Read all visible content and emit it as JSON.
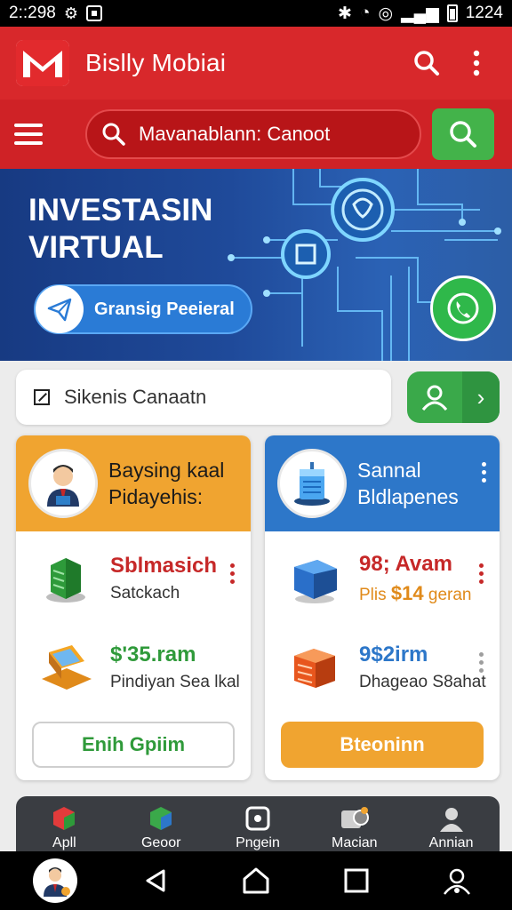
{
  "status_bar": {
    "time": "2::298",
    "right_text": "1224"
  },
  "app_bar": {
    "title": "Bislly Mobiai"
  },
  "search": {
    "placeholder": "Mavanablann: Canoot"
  },
  "banner": {
    "title": "INVESTASIN VIRTUAL",
    "button_label": "Gransig Peeieral"
  },
  "filter": {
    "label": "Sikenis Canaatn"
  },
  "cards": {
    "left": {
      "header_line1": "Baysing kaal",
      "header_line2": "Pidayehis:",
      "row1_title": "Sblmasich",
      "row1_sub": "Satckach",
      "row2_title": "$'35.ram",
      "row2_sub": "Pindiyan Sea lkal",
      "button": "Enih Gpiim"
    },
    "right": {
      "header_line1": "Sannal",
      "header_line2": "Bldlapenes",
      "row1_title": "98; Avam",
      "row1_sub_prefix": "Plis ",
      "row1_sub_amount": "$14",
      "row1_sub_suffix": " geran",
      "row2_title": "9$2irm",
      "row2_sub": "Dhageao S8ahat",
      "button": "Bteoninn"
    }
  },
  "dock": {
    "items": [
      {
        "label": "Apll"
      },
      {
        "label": "Geoor"
      },
      {
        "label": "Pngein"
      },
      {
        "label": "Macian"
      },
      {
        "label": "Annian"
      }
    ]
  },
  "colors": {
    "primary_red": "#d8282b",
    "accent_green": "#43b34a",
    "orange": "#f0a430",
    "blue": "#2d77c9"
  }
}
